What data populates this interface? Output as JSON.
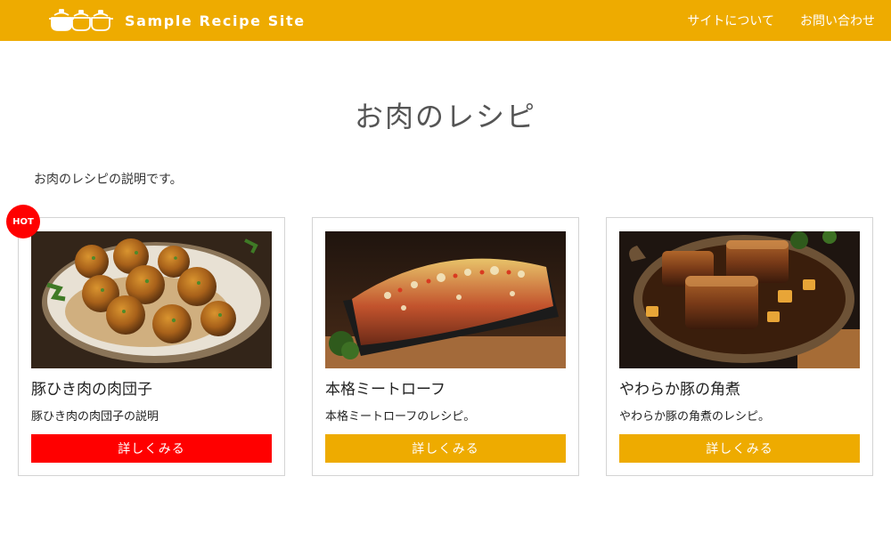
{
  "header": {
    "site_name": "Sample Recipe Site",
    "logo_icon": "pots-icon",
    "nav": [
      {
        "label": "サイトについて"
      },
      {
        "label": "お問い合わせ"
      }
    ]
  },
  "page": {
    "title": "お肉のレシピ",
    "description": "お肉のレシピの説明です。"
  },
  "badge": {
    "label": "HOT",
    "color": "#ff0000"
  },
  "cards": [
    {
      "title": "豚ひき肉の肉団子",
      "text": "豚ひき肉の肉団子の説明",
      "button": "詳しくみる",
      "button_color": "#ff0000",
      "image": "meatballs-image"
    },
    {
      "title": "本格ミートローフ",
      "text": "本格ミートローフのレシピ。",
      "button": "詳しくみる",
      "button_color": "#eeab00",
      "image": "meatloaf-image"
    },
    {
      "title": "やわらか豚の角煮",
      "text": "やわらか豚の角煮のレシピ。",
      "button": "詳しくみる",
      "button_color": "#eeab00",
      "image": "braised-pork-image"
    }
  ],
  "colors": {
    "header": "#eeab00",
    "accent_red": "#ff0000",
    "card_border": "#d4d4d4"
  }
}
